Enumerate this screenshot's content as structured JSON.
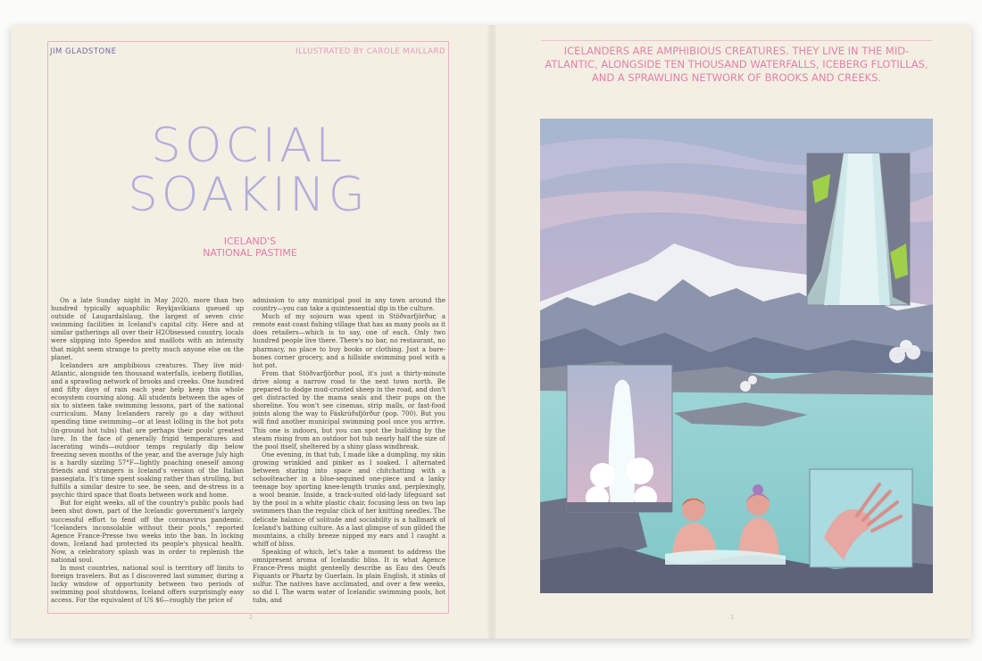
{
  "left_page": {
    "author": "JIM GLADSTONE",
    "illustrator": "ILLUSTRATED BY CAROLE MAILLARD",
    "title_line1": "SOCIAL",
    "title_line2": "SOAKING",
    "subtitle_line1": "ICELAND'S",
    "subtitle_line2": "NATIONAL PASTIME",
    "column1": [
      "On a late Sunday night in May 2020, more than two hundred typically aquaphilic Reykjavíkians queued up outside of Laugardalslaug, the largest of seven civic swimming facilities in Iceland's capital city. Here and at similar gatherings all over their H2Obsessed country, locals were slipping into Speedos and maillots with an intensity that might seem strange to pretty much anyone else on the planet.",
      "Icelanders are amphibious creatures. They live mid-Atlantic, alongside ten thousand waterfalls, iceberg flotillas, and a sprawling network of brooks and creeks. One hundred and fifty days of rain each year help keep this whole ecosystem coursing along. All students between the ages of six to sixteen take swimming lessons, part of the national curriculum. Many Icelanders rarely go a day without spending time swimming—or at least lolling in the hot pots (in-ground hot tubs) that are perhaps their pools' greatest lure. In the face of generally frigid temperatures and lacerating winds—outdoor temps regularly dip below freezing seven months of the year, and the average July high is a hardly sizzling 57°F—lightly poaching oneself among friends and strangers is Iceland's version of the Italian passegiata. It's time spent soaking rather than strolling, but fulfills a similar desire to see, be seen, and de-stress in a psychic third space that floats between work and home.",
      "But for eight weeks, all of the country's public pools had been shut down, part of the Icelandic government's largely successful effort to fend off the coronavirus pandemic. \"Icelanders inconsolable without their pools,\" reported Agence France-Presse two weeks into the ban. In locking down, Iceland had protected its people's physical health. Now, a celebratory splash was in order to replenish the national soul.",
      "In most countries, national soul is territory off limits to foreign travelers. But as I discovered last summer, during a lucky window of opportunity between two periods of swimming pool shutdowns, Iceland offers surprisingly easy access. For the equivalent of US $6—roughly the price of"
    ],
    "column2": [
      "admission to any municipal pool in any town around the country—you can take a quintessential dip in the culture.",
      "Much of my sojourn was spent in Stöðvarfjörður, a remote east coast fishing village that has as many pools as it does retailers—which is to say, one of each. Only two hundred people live there. There's no bar, no restaurant, no pharmacy, no place to buy books or clothing. Just a bare-bones corner grocery, and a hillside swimming pool with a hot pot.",
      "From that Stöðvarfjörður pool, it's just a thirty-minute drive along a narrow road to the next town north. Be prepared to dodge mud-crusted sheep in the road, and don't get distracted by the mama seals and their pups on the shoreline. You won't see cinemas, strip malls, or fast-food joints along the way to Fáskrúðsfjörður (pop. 700). But you will find another municipal swimming pool once you arrive. This one is indoors, but you can spot the building by the steam rising from an outdoor hot tub nearly half the size of the pool itself, sheltered by a shiny glass windbreak.",
      "One evening, in that tub, I made like a dumpling, my skin growing wrinkled and pinker as I soaked. I alternated between staring into space and chitchatting with a schoolteacher in a blue-sequined one-piece and a lanky teenage boy sporting knee-length trunks and, perplexingly, a wool beanie. Inside, a track-suited old-lady lifeguard sat by the pool in a white plastic chair, focusing less on two lap swimmers than the regular click of her knitting needles. The delicate balance of solitude and sociability is a hallmark of Iceland's bathing culture. As a last glimpse of sun gilded the mountains, a chilly breeze nipped my ears and I caught a whiff of bliss.",
      "Speaking of which, let's take a moment to address the omnipresent aroma of Icelandic bliss. It is what Agence France-Press might genteelly describe as Eau des Oeufs Fiquants or Phartz by Guerlain. In plain English, it stinks of sulfur. The natives have acclimated, and over a few weeks, so did I. The warm water of Icelandic swimming pools, hot tubs, and"
    ],
    "folio": "2"
  },
  "right_page": {
    "pull_quote": "Icelanders are amphibious creatures. They live in the mid-Atlantic, alongside ten thousand waterfalls, iceberg flotillas, and a sprawling network of brooks and creeks.",
    "folio": "3"
  },
  "colors": {
    "title": "#b3addb",
    "accent_pink": "#e47ba6",
    "author": "#6f6aa0",
    "paper": "#f4efe3"
  }
}
